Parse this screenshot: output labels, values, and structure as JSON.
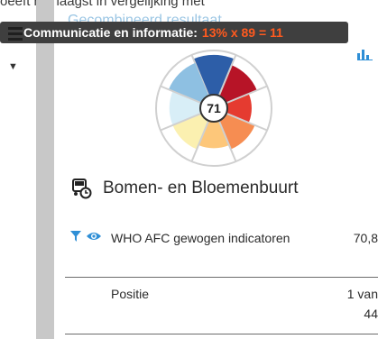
{
  "top_text": "oeeft het laagst in vergelijking met",
  "panel": {
    "title": "Gecombineerd resultaat"
  },
  "tooltip": {
    "label": "Communicatie en informatie:",
    "formula": "13% x 89  = 11"
  },
  "wheel": {
    "score": "71",
    "segments": [
      {
        "color": "#2d5ea8",
        "fill_fraction": 0.9
      },
      {
        "color": "#b71427",
        "fill_fraction": 0.75
      },
      {
        "color": "#e53b30",
        "fill_fraction": 0.55
      },
      {
        "color": "#f68d52",
        "fill_fraction": 0.7
      },
      {
        "color": "#fdc77a",
        "fill_fraction": 0.6
      },
      {
        "color": "#fbf0b0",
        "fill_fraction": 0.7
      },
      {
        "color": "#d8eef7",
        "fill_fraction": 0.7
      },
      {
        "color": "#8ec0e2",
        "fill_fraction": 0.8
      }
    ]
  },
  "location": {
    "name": "Bomen- en Bloemenbuurt"
  },
  "indicator": {
    "label": "WHO AFC gewogen indicatoren",
    "value": "70,8"
  },
  "position": {
    "label": "Positie",
    "value_line1": "1 van",
    "value_line2": "44"
  },
  "colors": {
    "accent": "#2f8fd6",
    "tooltip_bg": "#3f3f3f",
    "tooltip_highlight": "#ff5a1f",
    "rail": "#c8c8c8"
  }
}
